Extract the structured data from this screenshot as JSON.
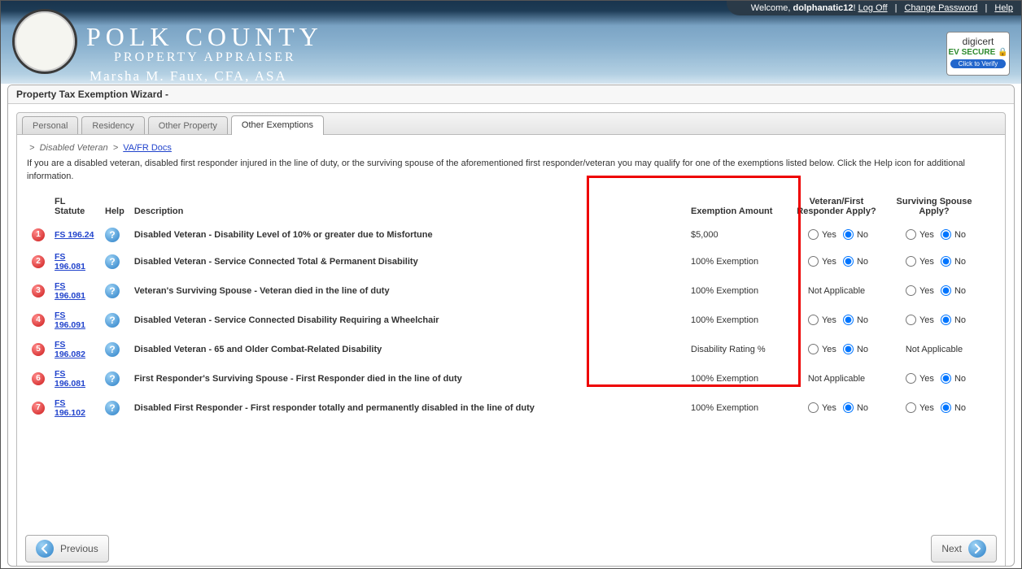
{
  "header": {
    "welcome_prefix": "Welcome, ",
    "username": "dolphanatic12",
    "welcome_suffix": "! ",
    "logoff": "Log Off",
    "change_password": "Change Password",
    "help": "Help",
    "title_line1": "POLK COUNTY",
    "title_line2": "PROPERTY APPRAISER",
    "title_line3": "Marsha M. Faux, CFA, ASA",
    "digicert_brand": "digicert",
    "digicert_ev": "EV SECURE",
    "digicert_verify": "Click to Verify"
  },
  "page": {
    "title": "Property Tax Exemption Wizard -"
  },
  "tabs": [
    {
      "label": "Personal",
      "active": false
    },
    {
      "label": "Residency",
      "active": false
    },
    {
      "label": "Other Property",
      "active": false
    },
    {
      "label": "Other Exemptions",
      "active": true
    }
  ],
  "breadcrumb": {
    "item1": "Disabled Veteran",
    "item2": "VA/FR Docs"
  },
  "intro": "If you are a disabled veteran, disabled first responder injured in the line of duty, or the surviving spouse of the aforementioned first responder/veteran you may qualify for one of the exemptions listed below. Click the Help icon for additional information.",
  "columns": {
    "statute": "FL Statute",
    "help": "Help",
    "description": "Description",
    "amount": "Exemption Amount",
    "vet_apply": "Veteran/First Responder Apply?",
    "spouse_apply": "Surviving Spouse Apply?"
  },
  "yes_label": "Yes",
  "no_label": "No",
  "na_label": "Not Applicable",
  "rows": [
    {
      "num": "1",
      "statute": "FS 196.24",
      "desc": "Disabled Veteran - Disability Level of 10% or greater due to Misfortune",
      "amount": "$5,000",
      "vet": "radio",
      "vet_sel": "No",
      "spouse": "radio",
      "spouse_sel": "No"
    },
    {
      "num": "2",
      "statute": "FS 196.081",
      "desc": "Disabled Veteran - Service Connected Total & Permanent Disability",
      "amount": "100% Exemption",
      "vet": "radio",
      "vet_sel": "No",
      "spouse": "radio",
      "spouse_sel": "No"
    },
    {
      "num": "3",
      "statute": "FS 196.081",
      "desc": "Veteran's Surviving Spouse - Veteran died in the line of duty",
      "amount": "100% Exemption",
      "vet": "na",
      "spouse": "radio",
      "spouse_sel": "No"
    },
    {
      "num": "4",
      "statute": "FS 196.091",
      "desc": "Disabled Veteran - Service Connected Disability Requiring a Wheelchair",
      "amount": "100% Exemption",
      "vet": "radio",
      "vet_sel": "No",
      "spouse": "radio",
      "spouse_sel": "No"
    },
    {
      "num": "5",
      "statute": "FS 196.082",
      "desc": "Disabled Veteran - 65 and Older Combat-Related Disability",
      "amount": "Disability Rating %",
      "vet": "radio",
      "vet_sel": "No",
      "spouse": "na"
    },
    {
      "num": "6",
      "statute": "FS 196.081",
      "desc": "First Responder's Surviving Spouse - First Responder died in the line of duty",
      "amount": "100% Exemption",
      "vet": "na",
      "spouse": "radio",
      "spouse_sel": "No"
    },
    {
      "num": "7",
      "statute": "FS 196.102",
      "desc": "Disabled First Responder - First responder totally and permanently disabled in the line of duty",
      "amount": "100% Exemption",
      "vet": "radio",
      "vet_sel": "No",
      "spouse": "radio",
      "spouse_sel": "No"
    }
  ],
  "nav": {
    "prev": "Previous",
    "next": "Next"
  }
}
